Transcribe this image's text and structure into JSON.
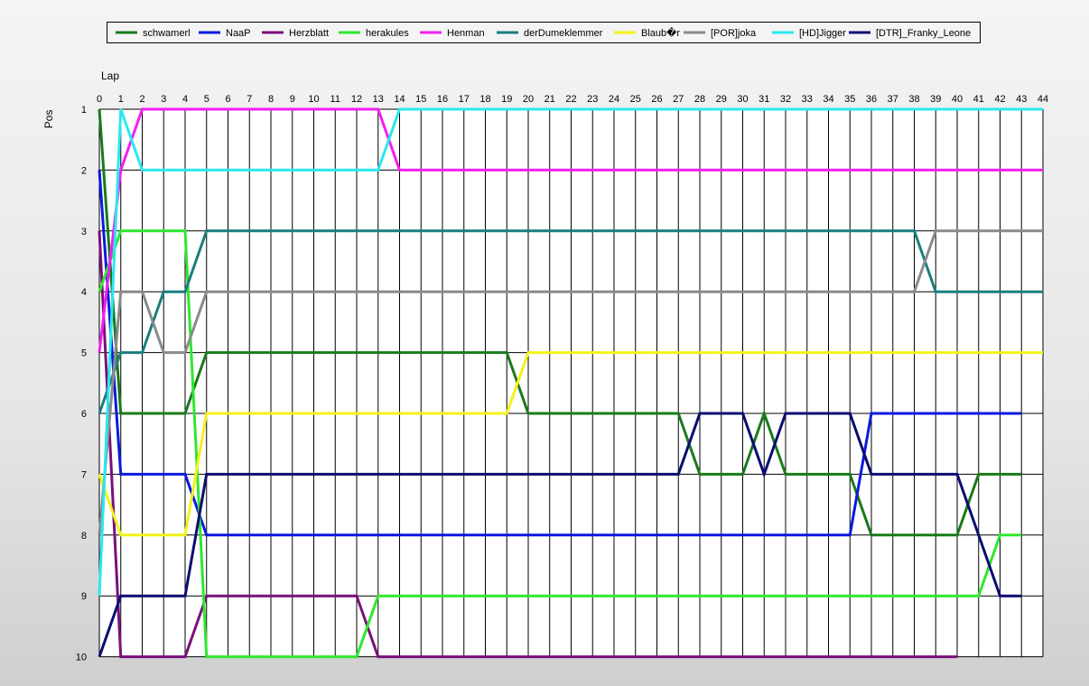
{
  "chart_data": {
    "type": "line",
    "xlabel": "Lap",
    "ylabel": "Pos",
    "x_categories": [
      "0",
      "1",
      "2",
      "3",
      "4",
      "5",
      "6",
      "7",
      "8",
      "9",
      "10",
      "11",
      "12",
      "13",
      "14",
      "15",
      "16",
      "17",
      "18",
      "19",
      "20",
      "21",
      "22",
      "23",
      "24",
      "25",
      "26",
      "27",
      "28",
      "29",
      "30",
      "31",
      "32",
      "33",
      "34",
      "35",
      "36",
      "37",
      "38",
      "39",
      "40",
      "41",
      "42",
      "43",
      "44"
    ],
    "y_ticks": [
      "1",
      "2",
      "3",
      "4",
      "5",
      "6",
      "7",
      "8",
      "9",
      "10"
    ],
    "xlim": [
      0,
      44
    ],
    "ylim": [
      1,
      10
    ],
    "y_inverted": true,
    "grid": true,
    "legend_position": "top",
    "series": [
      {
        "name": "schwamerl",
        "color": "#1a7a1a",
        "values": [
          1,
          6,
          6,
          6,
          6,
          5,
          5,
          5,
          5,
          5,
          5,
          5,
          5,
          5,
          5,
          5,
          5,
          5,
          5,
          5,
          6,
          6,
          6,
          6,
          6,
          6,
          6,
          6,
          7,
          7,
          7,
          6,
          7,
          7,
          7,
          7,
          8,
          8,
          8,
          8,
          8,
          7,
          7,
          7
        ]
      },
      {
        "name": "NaaP",
        "color": "#0a1ae0",
        "values": [
          2,
          7,
          7,
          7,
          7,
          8,
          8,
          8,
          8,
          8,
          8,
          8,
          8,
          8,
          8,
          8,
          8,
          8,
          8,
          8,
          8,
          8,
          8,
          8,
          8,
          8,
          8,
          8,
          8,
          8,
          8,
          8,
          8,
          8,
          8,
          8,
          6,
          6,
          6,
          6,
          6,
          6,
          6,
          6
        ]
      },
      {
        "name": "Herzblatt",
        "color": "#7a0f7a",
        "values": [
          3,
          10,
          10,
          10,
          10,
          9,
          9,
          9,
          9,
          9,
          9,
          9,
          9,
          10,
          10,
          10,
          10,
          10,
          10,
          10,
          10,
          10,
          10,
          10,
          10,
          10,
          10,
          10,
          10,
          10,
          10,
          10,
          10,
          10,
          10,
          10,
          10,
          10,
          10,
          10,
          10
        ]
      },
      {
        "name": "herakules",
        "color": "#2ee82e",
        "values": [
          4,
          3,
          3,
          3,
          3,
          10,
          10,
          10,
          10,
          10,
          10,
          10,
          10,
          9,
          9,
          9,
          9,
          9,
          9,
          9,
          9,
          9,
          9,
          9,
          9,
          9,
          9,
          9,
          9,
          9,
          9,
          9,
          9,
          9,
          9,
          9,
          9,
          9,
          9,
          9,
          9,
          9,
          8,
          8
        ]
      },
      {
        "name": "Henman",
        "color": "#f31ef3",
        "values": [
          5,
          2,
          1,
          1,
          1,
          1,
          1,
          1,
          1,
          1,
          1,
          1,
          1,
          1,
          2,
          2,
          2,
          2,
          2,
          2,
          2,
          2,
          2,
          2,
          2,
          2,
          2,
          2,
          2,
          2,
          2,
          2,
          2,
          2,
          2,
          2,
          2,
          2,
          2,
          2,
          2,
          2,
          2,
          2,
          2
        ]
      },
      {
        "name": "derDumeklemmer",
        "color": "#1a7e7e",
        "values": [
          6,
          5,
          5,
          4,
          4,
          3,
          3,
          3,
          3,
          3,
          3,
          3,
          3,
          3,
          3,
          3,
          3,
          3,
          3,
          3,
          3,
          3,
          3,
          3,
          3,
          3,
          3,
          3,
          3,
          3,
          3,
          3,
          3,
          3,
          3,
          3,
          3,
          3,
          3,
          4,
          4,
          4,
          4,
          4,
          4
        ]
      },
      {
        "name": "Blaub�r",
        "color": "#f2f21a",
        "values": [
          7,
          8,
          8,
          8,
          8,
          6,
          6,
          6,
          6,
          6,
          6,
          6,
          6,
          6,
          6,
          6,
          6,
          6,
          6,
          6,
          5,
          5,
          5,
          5,
          5,
          5,
          5,
          5,
          5,
          5,
          5,
          5,
          5,
          5,
          5,
          5,
          5,
          5,
          5,
          5,
          5,
          5,
          5,
          5,
          5
        ]
      },
      {
        "name": "[POR]joka",
        "color": "#8a8a8a",
        "values": [
          8,
          4,
          4,
          5,
          5,
          4,
          4,
          4,
          4,
          4,
          4,
          4,
          4,
          4,
          4,
          4,
          4,
          4,
          4,
          4,
          4,
          4,
          4,
          4,
          4,
          4,
          4,
          4,
          4,
          4,
          4,
          4,
          4,
          4,
          4,
          4,
          4,
          4,
          4,
          3,
          3,
          3,
          3,
          3,
          3
        ]
      },
      {
        "name": "[HD]Jigger",
        "color": "#2ae8f0",
        "values": [
          9,
          1,
          2,
          2,
          2,
          2,
          2,
          2,
          2,
          2,
          2,
          2,
          2,
          2,
          1,
          1,
          1,
          1,
          1,
          1,
          1,
          1,
          1,
          1,
          1,
          1,
          1,
          1,
          1,
          1,
          1,
          1,
          1,
          1,
          1,
          1,
          1,
          1,
          1,
          1,
          1,
          1,
          1,
          1,
          1
        ]
      },
      {
        "name": "[DTR]_Franky_Leone",
        "color": "#0c0c72",
        "values": [
          10,
          9,
          9,
          9,
          9,
          7,
          7,
          7,
          7,
          7,
          7,
          7,
          7,
          7,
          7,
          7,
          7,
          7,
          7,
          7,
          7,
          7,
          7,
          7,
          7,
          7,
          7,
          7,
          6,
          6,
          6,
          7,
          6,
          6,
          6,
          6,
          7,
          7,
          7,
          7,
          7,
          8,
          9,
          9
        ]
      }
    ]
  }
}
